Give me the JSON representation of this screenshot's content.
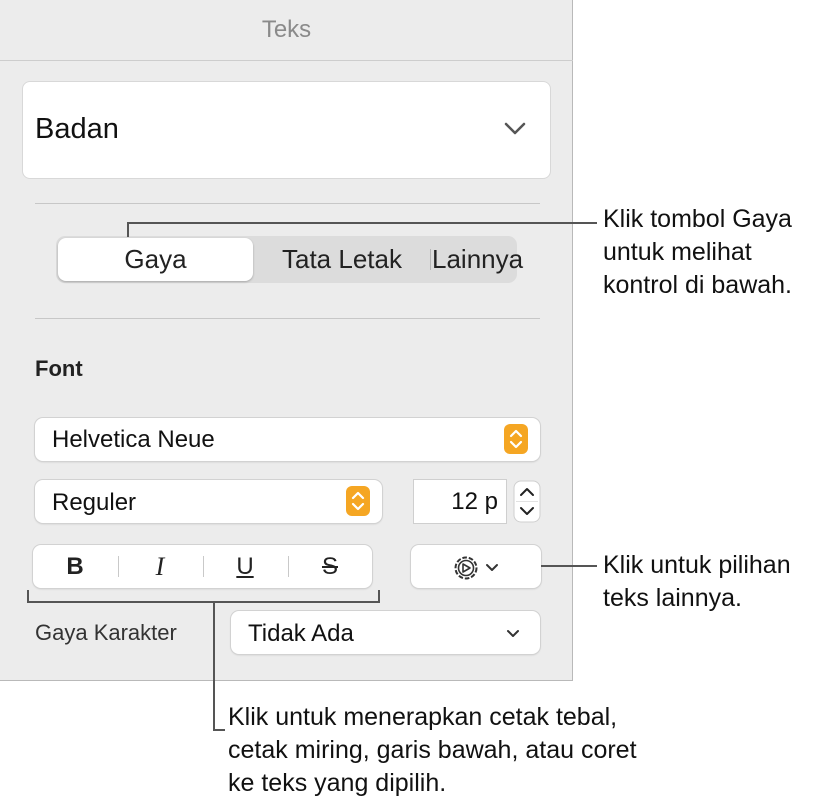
{
  "panel": {
    "title": "Teks",
    "paragraph_style": "Badan"
  },
  "tabs": {
    "items": [
      "Gaya",
      "Tata Letak",
      "Lainnya"
    ],
    "active": "Gaya"
  },
  "font": {
    "section_label": "Font",
    "family": "Helvetica Neue",
    "typeface": "Reguler",
    "size": "12 p"
  },
  "format_buttons": [
    "B",
    "I",
    "U",
    "S"
  ],
  "character_style": {
    "label": "Gaya Karakter",
    "value": "Tidak Ada"
  },
  "callouts": {
    "tabs": [
      "Klik tombol Gaya",
      "untuk melihat",
      "kontrol di bawah."
    ],
    "options": [
      "Klik untuk pilihan",
      "teks lainnya."
    ],
    "format": [
      "Klik untuk menerapkan cetak tebal,",
      "cetak miring, garis bawah, atau coret",
      "ke teks yang dipilih."
    ]
  },
  "colors": {
    "accent": "#f5a623",
    "panel_bg": "#ececec"
  }
}
